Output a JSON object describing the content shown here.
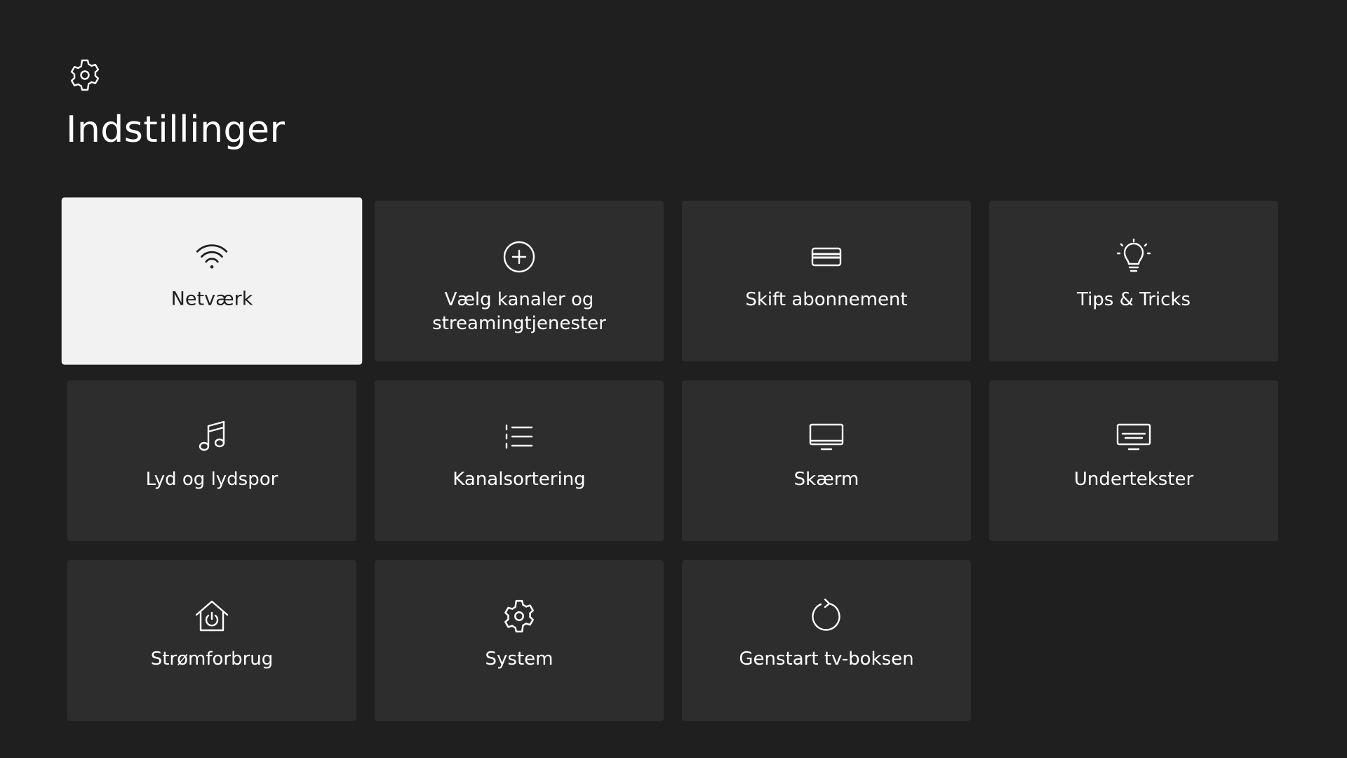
{
  "header": {
    "icon": "gear-icon",
    "title": "Indstillinger"
  },
  "colors": {
    "background": "#1f1f1f",
    "tile": "#2d2d2d",
    "tile_focused": "#f2f2f2",
    "text": "#ffffff",
    "text_focused": "#1f1f1f"
  },
  "tiles": [
    {
      "label": "Netværk",
      "icon": "wifi-icon",
      "focused": true
    },
    {
      "label": "Vælg kanaler og\nstreamingtjenester",
      "icon": "plus-circle-icon",
      "focused": false
    },
    {
      "label": "Skift abonnement",
      "icon": "credit-card-icon",
      "focused": false
    },
    {
      "label": "Tips & Tricks",
      "icon": "lightbulb-icon",
      "focused": false
    },
    {
      "label": "Lyd og lydspor",
      "icon": "music-note-icon",
      "focused": false
    },
    {
      "label": "Kanalsortering",
      "icon": "list-icon",
      "focused": false
    },
    {
      "label": "Skærm",
      "icon": "monitor-icon",
      "focused": false
    },
    {
      "label": "Undertekster",
      "icon": "subtitles-icon",
      "focused": false
    },
    {
      "label": "Strømforbrug",
      "icon": "home-power-icon",
      "focused": false
    },
    {
      "label": "System",
      "icon": "gear-icon",
      "focused": false
    },
    {
      "label": "Genstart tv-boksen",
      "icon": "restart-icon",
      "focused": false
    }
  ]
}
